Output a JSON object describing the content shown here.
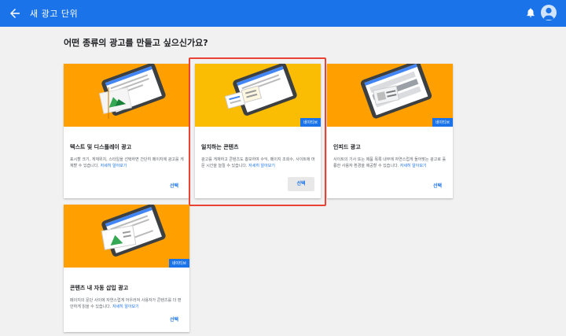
{
  "topbar": {
    "title": "새 광고 단위",
    "background": "#1a73e8"
  },
  "page": {
    "question": "어떤 종류의 광고를 만들고 싶으신가요?"
  },
  "cards": [
    {
      "title": "텍스트 및 디스플레이 광고",
      "description": "표시할 크기, 게재위치, 스타일을 선택하면 간단히 페이지에 광고를 게재할 수 있습니다.",
      "link": "자세히 알아보기",
      "select": "선택",
      "hero_color": "#ffa000"
    },
    {
      "title": "일치하는 콘텐츠",
      "description": "광고를 게재하고 콘텐츠도 홍보하여 수익, 페이지 조회수, 사이트에 머문 시간을 늘릴 수 있습니다.",
      "link": "자세히 알아보기",
      "select": "선택",
      "tag": "네이티브",
      "hero_color": "#fbbc04"
    },
    {
      "title": "인피드 광고",
      "description": "사이트의 기사 또는 제품 목록 내부에 자연스럽게 들어맞는 광고로 훌륭한 사용자 환경을 제공할 수 있습니다.",
      "link": "자세히 알아보기",
      "select": "선택",
      "tag": "네이티브",
      "hero_color": "#ffa000"
    },
    {
      "title": "콘텐츠 내 자동 삽입 광고",
      "description": "페이지의 문단 사이에 자연스럽게 어우러져 사용자가 콘텐츠를 더 편안하게 읽을 수 있습니다.",
      "link": "자세히 알아보기",
      "select": "선택",
      "tag": "네이티브",
      "hero_color": "#ffa000"
    }
  ],
  "highlight_color": "#ea4335",
  "icons": [
    "back-arrow-icon",
    "bell-icon",
    "avatar-icon"
  ]
}
